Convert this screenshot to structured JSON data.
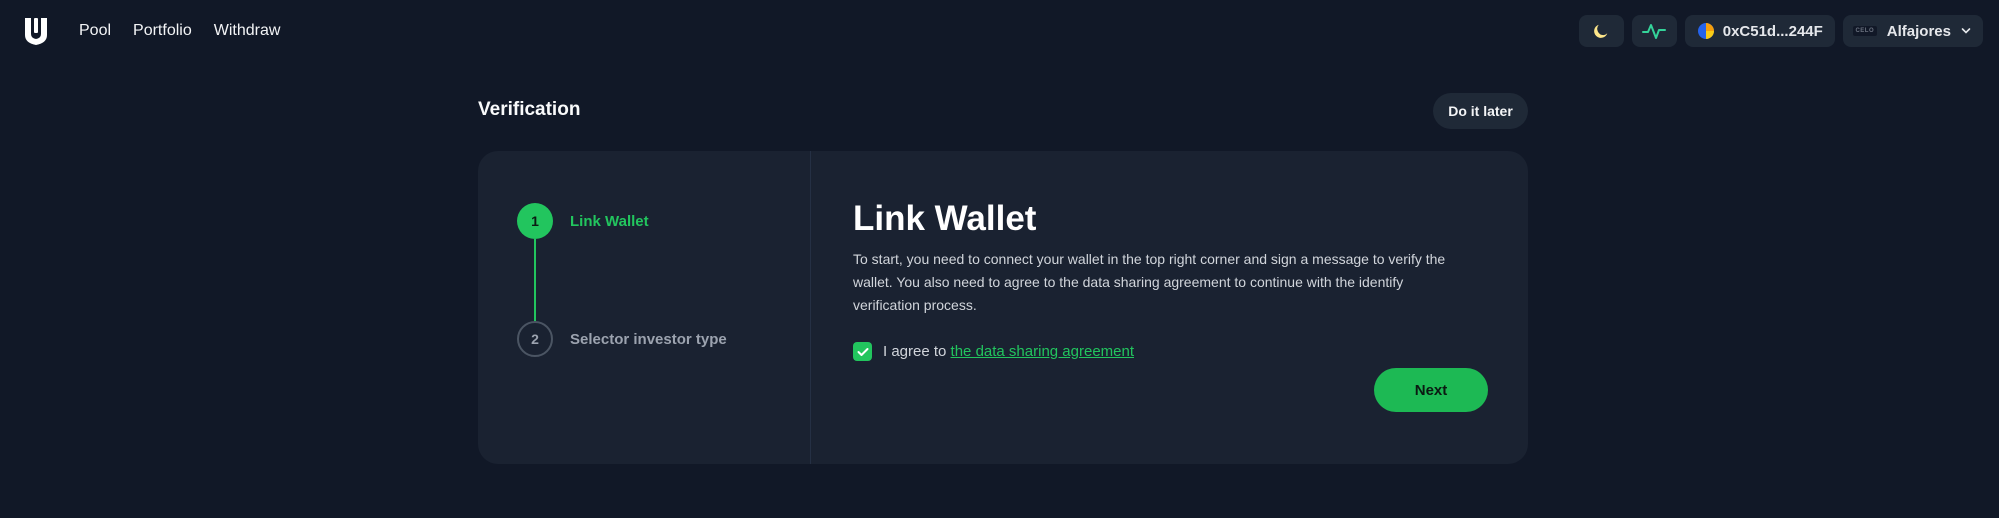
{
  "nav": {
    "items": [
      "Pool",
      "Portfolio",
      "Withdraw"
    ]
  },
  "header": {
    "wallet_address": "0xC51d...244F",
    "network_name": "Alfajores",
    "network_logo_text": "CELO"
  },
  "page": {
    "title": "Verification",
    "skip_label": "Do it later"
  },
  "steps": [
    {
      "number": "1",
      "label": "Link Wallet",
      "state": "active"
    },
    {
      "number": "2",
      "label": "Selector investor type",
      "state": "pending"
    }
  ],
  "main": {
    "heading": "Link Wallet",
    "description": "To start, you need to connect your wallet in the top right corner and sign a message to verify the wallet. You also need to agree to the data sharing agreement to continue with the identify verification process.",
    "agree_prefix": "I agree to ",
    "agree_link": "the data sharing agreement",
    "agree_checked": true,
    "next_label": "Next"
  },
  "colors": {
    "background": "#111827",
    "card": "#1a2231",
    "accent": "#22c55e"
  },
  "icons": [
    "logo-icon",
    "moon-icon",
    "activity-icon",
    "wallet-avatar-icon",
    "chevron-down-icon",
    "check-icon"
  ]
}
